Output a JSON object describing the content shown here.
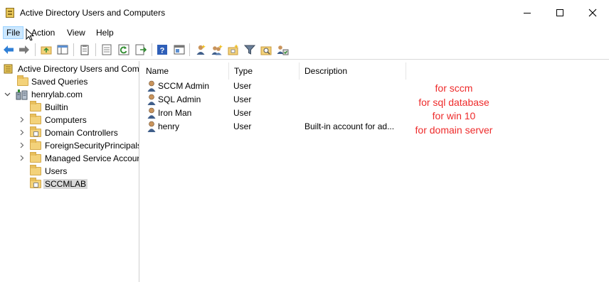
{
  "window": {
    "title": "Active Directory Users and Computers",
    "controls": {
      "minimize": "—",
      "maximize": "☐",
      "close": "✕"
    }
  },
  "menu": [
    {
      "label": "File",
      "active": true
    },
    {
      "label": "Action",
      "active": false
    },
    {
      "label": "View",
      "active": false
    },
    {
      "label": "Help",
      "active": false
    }
  ],
  "toolbar": {
    "icons": [
      "back-arrow-icon",
      "forward-arrow-icon",
      "folder-up-icon",
      "show-tree-icon",
      "clipboard-icon",
      "properties-icon",
      "refresh-icon",
      "export-list-icon",
      "help-icon",
      "console-icon",
      "new-user-icon",
      "new-group-icon",
      "new-ou-icon",
      "filter-icon",
      "find-icon",
      "delegate-icon"
    ]
  },
  "tree": {
    "root": "Active Directory Users and Com",
    "saved_queries": "Saved Queries",
    "domain": "henrylab.com",
    "children": [
      {
        "label": "Builtin",
        "expandable": false,
        "type": "folder"
      },
      {
        "label": "Computers",
        "expandable": true,
        "type": "folder"
      },
      {
        "label": "Domain Controllers",
        "expandable": true,
        "type": "ou"
      },
      {
        "label": "ForeignSecurityPrincipals",
        "expandable": true,
        "type": "folder"
      },
      {
        "label": "Managed Service Accour",
        "expandable": true,
        "type": "folder"
      },
      {
        "label": "Users",
        "expandable": false,
        "type": "folder"
      },
      {
        "label": "SCCMLAB",
        "expandable": false,
        "type": "ou",
        "selected": true
      }
    ]
  },
  "list": {
    "columns": [
      "Name",
      "Type",
      "Description"
    ],
    "rows": [
      {
        "name": "SCCM Admin",
        "type": "User",
        "description": ""
      },
      {
        "name": "SQL Admin",
        "type": "User",
        "description": ""
      },
      {
        "name": "Iron Man",
        "type": "User",
        "description": ""
      },
      {
        "name": "henry",
        "type": "User",
        "description": "Built-in account for ad..."
      }
    ]
  },
  "annotations": [
    "for sccm",
    "for sql database",
    "for win 10",
    "for domain server"
  ],
  "colors": {
    "annotation": "#ee2b2b",
    "selection": "#d9d9d9",
    "menu_highlight": "#cce8ff"
  }
}
